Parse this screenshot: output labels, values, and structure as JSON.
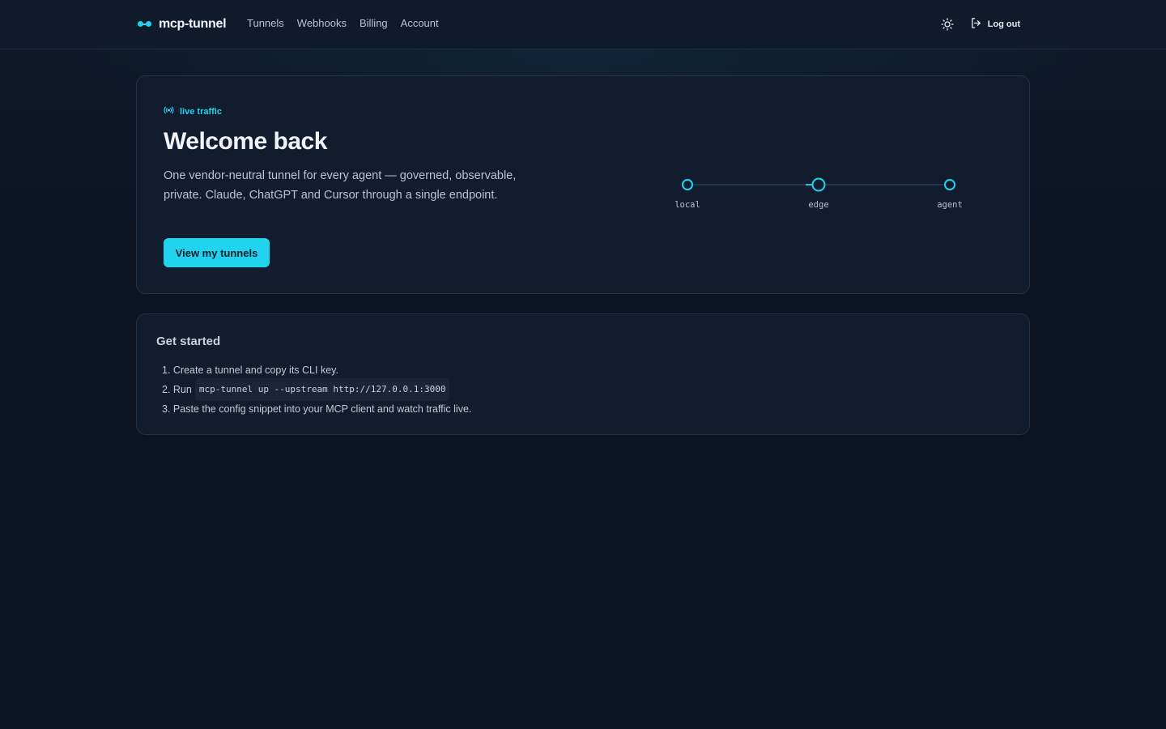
{
  "brand": {
    "name": "mcp-tunnel"
  },
  "nav": [
    {
      "label": "Tunnels"
    },
    {
      "label": "Webhooks"
    },
    {
      "label": "Billing"
    },
    {
      "label": "Account"
    }
  ],
  "header": {
    "logout_label": "Log out",
    "theme_icon": "sun-icon",
    "logout_icon": "logout-icon"
  },
  "hero": {
    "badge": "live traffic",
    "title": "Welcome back",
    "description": "One vendor-neutral tunnel for every agent — governed, observable, private. Claude, ChatGPT and Cursor through a single endpoint.",
    "cta_label": "View my tunnels",
    "flow": {
      "nodes": [
        "local",
        "edge",
        "agent"
      ]
    }
  },
  "get_started": {
    "title": "Get started",
    "steps": [
      {
        "prefix": "1. ",
        "text": "Create a tunnel and copy its CLI key."
      },
      {
        "prefix": "2. ",
        "text": "Run",
        "code": "mcp-tunnel up --upstream http://127.0.0.1:3000"
      },
      {
        "prefix": "3. ",
        "text": "Paste the config snippet into your MCP client and watch traffic live."
      }
    ]
  },
  "colors": {
    "accent": "#22d3ee",
    "background": "#0c1424",
    "card": "#111c2e",
    "border": "#233247"
  }
}
